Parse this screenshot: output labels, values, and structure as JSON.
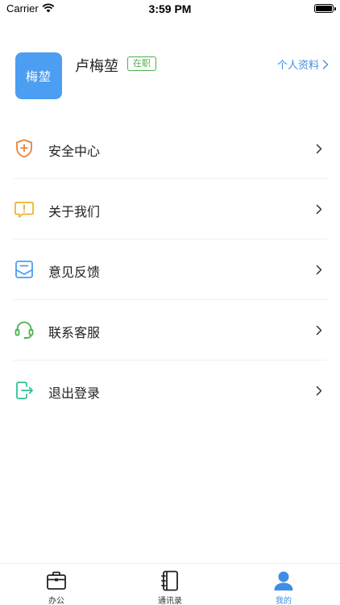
{
  "status_bar": {
    "carrier": "Carrier",
    "time": "3:59 PM"
  },
  "profile": {
    "avatar_text": "梅堃",
    "name": "卢梅堃",
    "status_badge": "在职",
    "profile_link": "个人资料"
  },
  "menu": {
    "items": [
      {
        "label": "安全中心",
        "icon": "shield-plus-icon",
        "color": "#e8833a"
      },
      {
        "label": "关于我们",
        "icon": "alert-message-icon",
        "color": "#f0b429"
      },
      {
        "label": "意见反馈",
        "icon": "feedback-inbox-icon",
        "color": "#4b9ef2"
      },
      {
        "label": "联系客服",
        "icon": "headset-icon",
        "color": "#4cb04c"
      },
      {
        "label": "退出登录",
        "icon": "logout-icon",
        "color": "#2fbf9a"
      }
    ]
  },
  "tabs": [
    {
      "label": "办公",
      "icon": "briefcase-icon"
    },
    {
      "label": "通讯录",
      "icon": "contacts-book-icon"
    },
    {
      "label": "我的",
      "icon": "user-icon",
      "active": true
    }
  ],
  "colors": {
    "accent": "#3f8ee6",
    "avatar_bg": "#4b9ef2",
    "badge": "#4cb04c"
  }
}
